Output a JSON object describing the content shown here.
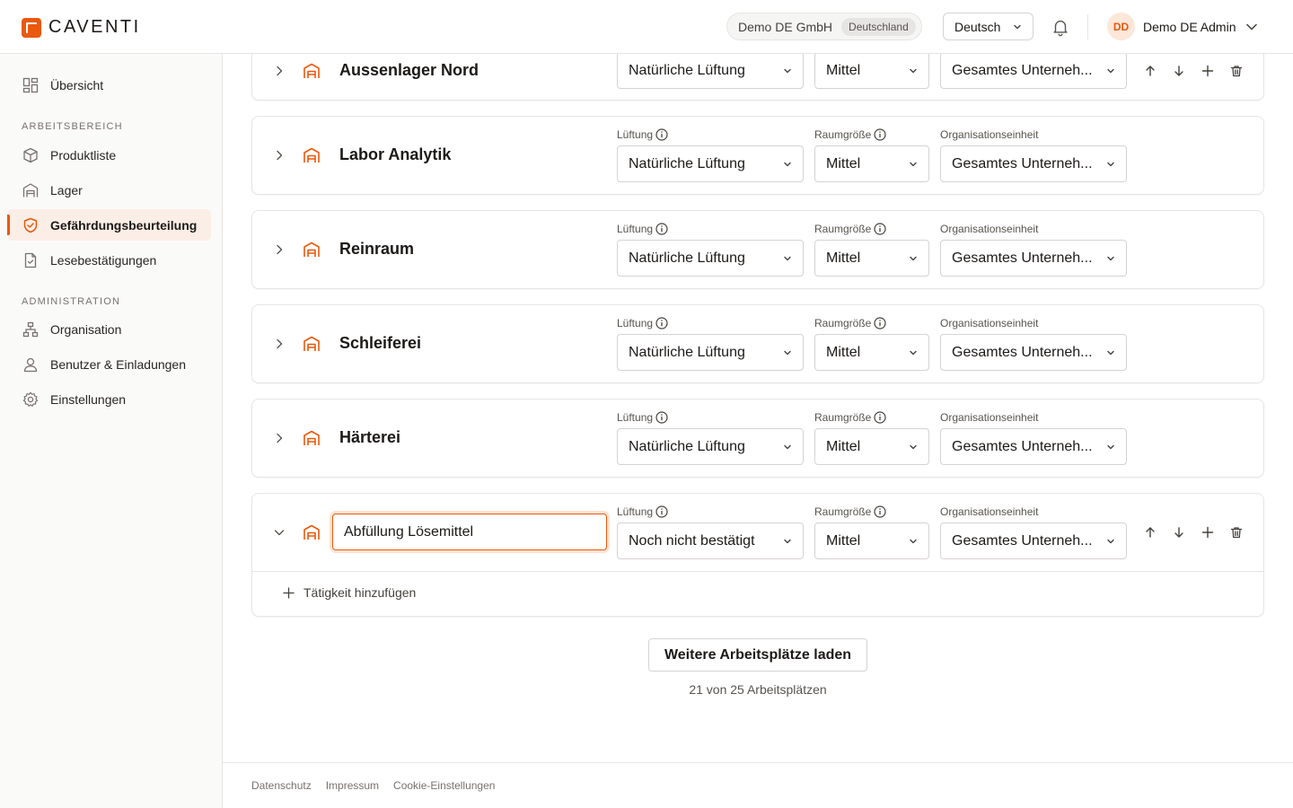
{
  "header": {
    "brand": "CAVENTI",
    "brand_color": "#ea580c",
    "tenant_name": "Demo DE GmbH",
    "tenant_country": "Deutschland",
    "language": "Deutsch",
    "avatar_initials": "DD",
    "user_name": "Demo DE Admin"
  },
  "sidebar": {
    "overview": "Übersicht",
    "section_workspace": "ARBEITSBEREICH",
    "workspace_items": [
      {
        "label": "Produktliste",
        "icon": "box-icon"
      },
      {
        "label": "Lager",
        "icon": "warehouse-icon"
      },
      {
        "label": "Gefährdungsbeurteilung",
        "icon": "shield-check-icon",
        "active": true
      },
      {
        "label": "Lesebestätigungen",
        "icon": "document-check-icon"
      }
    ],
    "section_admin": "ADMINISTRATION",
    "admin_items": [
      {
        "label": "Organisation",
        "icon": "org-chart-icon"
      },
      {
        "label": "Benutzer & Einladungen",
        "icon": "user-icon"
      },
      {
        "label": "Einstellungen",
        "icon": "gear-icon"
      }
    ]
  },
  "labels": {
    "ventilation": "Lüftung",
    "room_size": "Raumgröße",
    "org_unit": "Organisationseinheit"
  },
  "workplaces": [
    {
      "name": "Aussenlager Nord",
      "ventilation": "Natürliche Lüftung",
      "room_size": "Mittel",
      "org_unit": "Gesamtes Unterneh..."
    },
    {
      "name": "Labor Analytik",
      "ventilation": "Natürliche Lüftung",
      "room_size": "Mittel",
      "org_unit": "Gesamtes Unterneh..."
    },
    {
      "name": "Reinraum",
      "ventilation": "Natürliche Lüftung",
      "room_size": "Mittel",
      "org_unit": "Gesamtes Unterneh..."
    },
    {
      "name": "Schleiferei",
      "ventilation": "Natürliche Lüftung",
      "room_size": "Mittel",
      "org_unit": "Gesamtes Unterneh..."
    },
    {
      "name": "Härterei",
      "ventilation": "Natürliche Lüftung",
      "room_size": "Mittel",
      "org_unit": "Gesamtes Unterneh..."
    },
    {
      "name": "Abfüllung Lösemittel",
      "ventilation": "Noch nicht bestätigt",
      "room_size": "Mittel",
      "org_unit": "Gesamtes Unterneh...",
      "expanded": true,
      "editing": true
    }
  ],
  "add_activity": "Tätigkeit hinzufügen",
  "load_more": "Weitere Arbeitsplätze laden",
  "count_text": "21 von 25 Arbeitsplätzen",
  "footer": {
    "privacy": "Datenschutz",
    "imprint": "Impressum",
    "cookies": "Cookie-Einstellungen"
  }
}
